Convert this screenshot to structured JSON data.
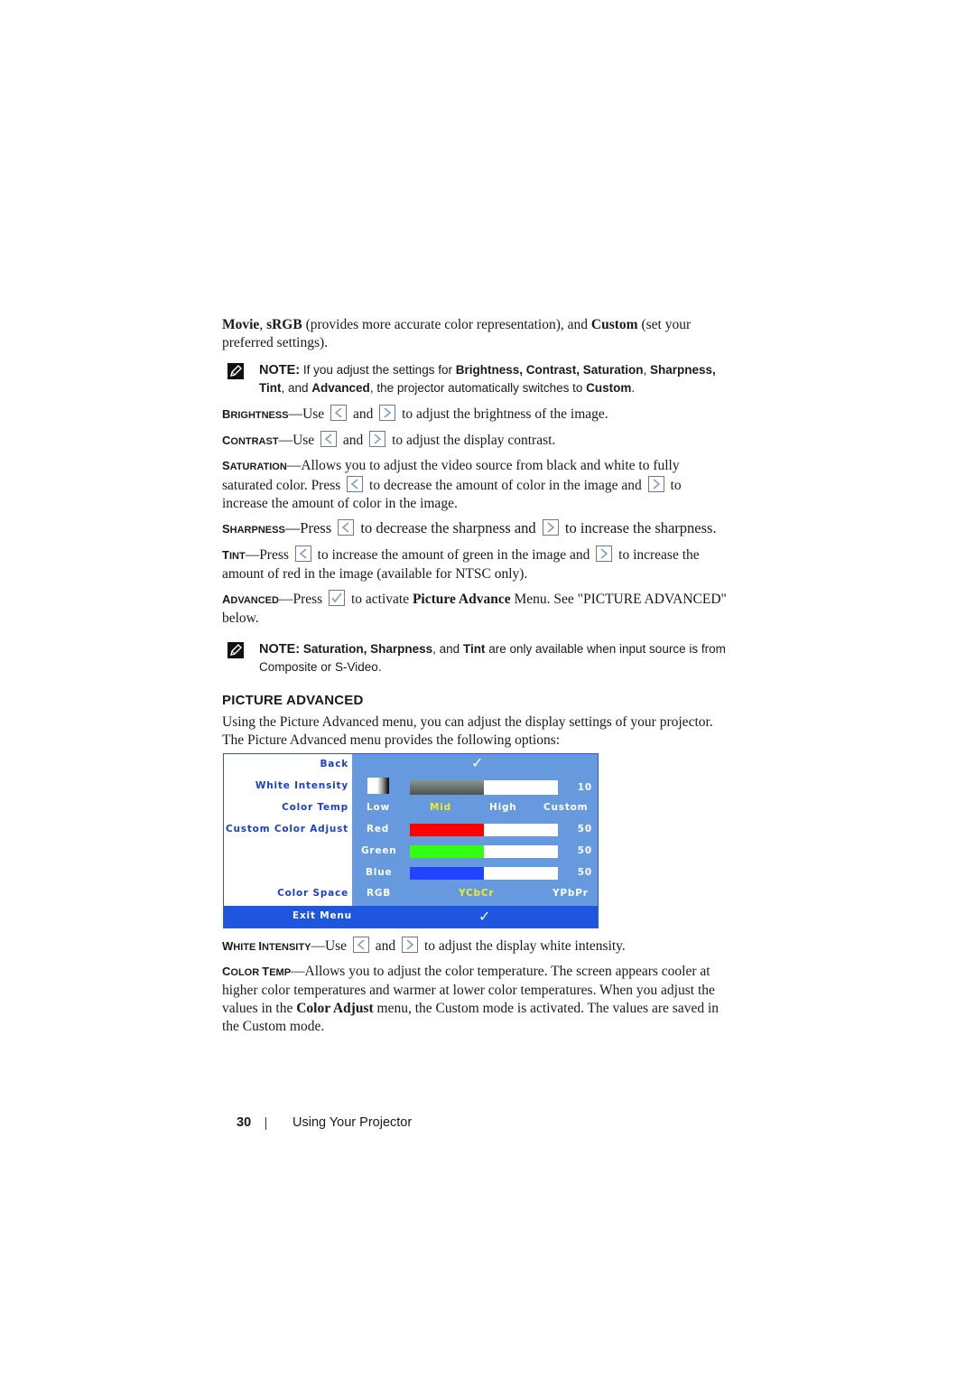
{
  "intro": {
    "parts": [
      "Movie",
      ", ",
      "sRGB",
      " (provides more accurate color representation), and ",
      "Custom",
      " (set your preferred settings)."
    ]
  },
  "note1": {
    "label": "NOTE:",
    "t1": " If you adjust the settings for ",
    "b1": "Brightness, Contrast, Saturation",
    "t2": ", ",
    "b2": "Sharpness, Tint",
    "t3": ", and ",
    "b3": "Advanced",
    "t4": ", the projector automatically switches to ",
    "b4": "Custom",
    "t5": "."
  },
  "brightness": {
    "term_first": "B",
    "term_rest": "RIGHTNESS",
    "dash": "—Use",
    "and": "and",
    "rest": "to adjust the brightness of the image."
  },
  "contrast": {
    "term_first": "C",
    "term_rest": "ONTRAST",
    "dash": "—Use",
    "and": "and",
    "rest": "to adjust the display contrast."
  },
  "saturation": {
    "term_first": "S",
    "term_rest": "ATURATION",
    "t1": "—Allows you to adjust the video source from black and white to fully saturated color. Press",
    "t2": "to decrease the amount of color in the image and",
    "t3": "to increase the amount of color in the image."
  },
  "sharpness": {
    "term_first": "S",
    "term_rest": "HARPNESS",
    "t1": "—Press",
    "t2": "to decrease the sharpness and",
    "t3": "to increase the sharpness."
  },
  "tint": {
    "term_first": "T",
    "term_rest": "INT",
    "t1": "—Press",
    "t2": "to increase the amount of green in the image and",
    "t3": "to increase the amount of red in the image (available for NTSC only)."
  },
  "advanced": {
    "term_first": "A",
    "term_rest": "DVANCED",
    "t1": "—Press",
    "t2": "to activate ",
    "b1": "Picture Advance",
    "t3": " Menu. See \"PICTURE ADVANCED\" below."
  },
  "note2": {
    "label": "NOTE:",
    "b1": " Saturation, Sharpness",
    "t1": ", and ",
    "b2": "Tint",
    "t2": " are only available when input source is from Composite or S-Video."
  },
  "section": {
    "heading": "PICTURE ADVANCED",
    "body": "Using the Picture Advanced menu, you can adjust the display settings of your projector. The Picture Advanced menu provides the following options:"
  },
  "osd": {
    "left_items": [
      "Back",
      "White Intensity",
      "Color Temp",
      "Custom Color Adjust",
      "Color Space"
    ],
    "exit_label": "Exit Menu",
    "check_glyph": "✓",
    "white_intensity": {
      "value": "10",
      "fraction": 0.5
    },
    "color_temp": {
      "options": [
        "Low",
        "Mid",
        "High",
        "Custom"
      ],
      "selected": "Mid"
    },
    "color_adjust": [
      {
        "label": "Red",
        "value": "50",
        "fraction": 0.5,
        "color": "#ff0000"
      },
      {
        "label": "Green",
        "value": "50",
        "fraction": 0.5,
        "color": "#33ff11"
      },
      {
        "label": "Blue",
        "value": "50",
        "fraction": 0.5,
        "color": "#2244ff"
      }
    ],
    "color_space": {
      "options": [
        "RGB",
        "YCbCr",
        "YPbPr"
      ],
      "selected": "YCbCr"
    },
    "colors": {
      "panel": "#6699dd",
      "exit_bar": "#1f56e0",
      "left_text": "#1a3fd0",
      "selected": "#eeee22"
    }
  },
  "white_intensity_desc": {
    "term_first": "W",
    "term_rest": "HITE ",
    "term_first2": "I",
    "term_rest2": "NTENSITY",
    "dash": "—Use",
    "and": "and",
    "rest": "to adjust the display white intensity."
  },
  "color_temp_desc": {
    "term_first": "C",
    "term_rest": "OLOR ",
    "term_first2": "T",
    "term_rest2": "EMP",
    "t1": "—Allows you to adjust the color temperature. The screen appears cooler at higher color temperatures and warmer at lower color temperatures. When you adjust the values in the ",
    "b1": "Color Adjust",
    "t2": " menu, the Custom mode is activated. The values are saved in the Custom mode."
  },
  "footer": {
    "page_number": "30",
    "section_title": "Using Your Projector"
  }
}
